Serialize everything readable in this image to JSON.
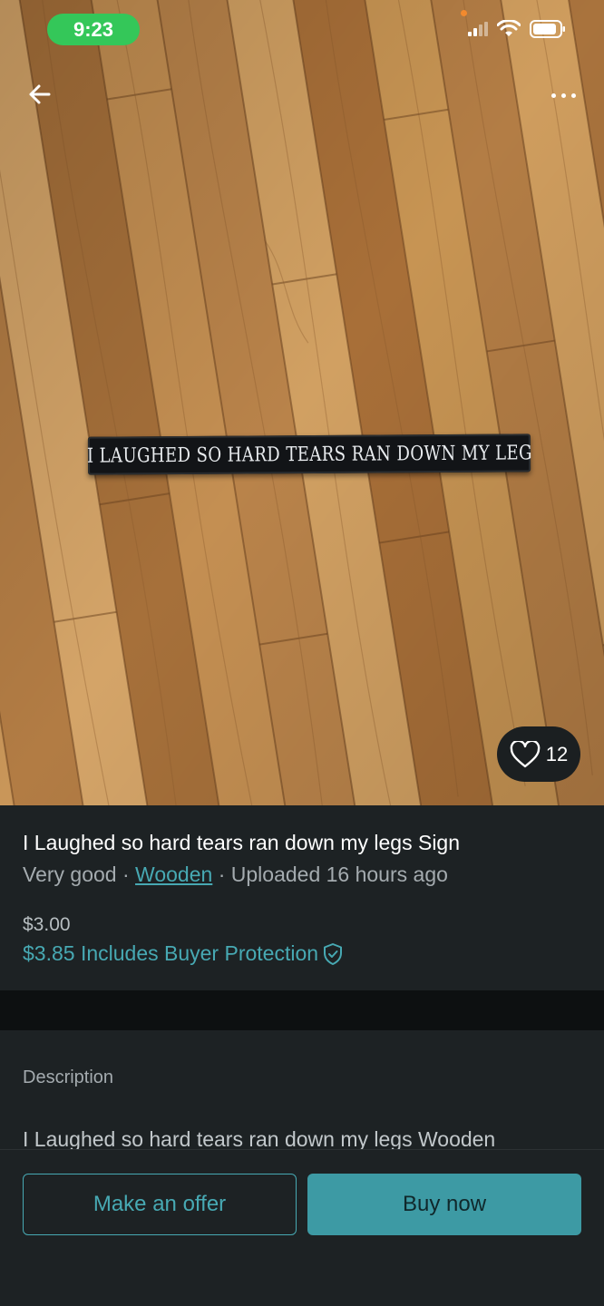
{
  "status_bar": {
    "time": "9:23"
  },
  "photo": {
    "sign_text": "I LAUGHED SO HARD TEARS RAN DOWN MY LEG",
    "favorite_count": "12"
  },
  "item": {
    "title": "I Laughed so hard tears ran down my legs Sign",
    "condition": "Very good",
    "separator": "·",
    "material": "Wooden",
    "uploaded": "Uploaded 16 hours ago",
    "price": "$3.00",
    "price_with_protection": "$3.85 Includes Buyer Protection"
  },
  "description": {
    "label": "Description",
    "text": "I Laughed so hard tears ran down my legs Wooden"
  },
  "actions": {
    "offer_label": "Make an offer",
    "buy_label": "Buy now"
  },
  "colors": {
    "accent": "#47a9b3",
    "background": "#1d2224",
    "status_pill": "#34c759"
  },
  "icons": [
    "back-arrow-icon",
    "more-icon",
    "heart-icon",
    "shield-check-icon",
    "signal-icon",
    "wifi-icon",
    "battery-icon"
  ]
}
